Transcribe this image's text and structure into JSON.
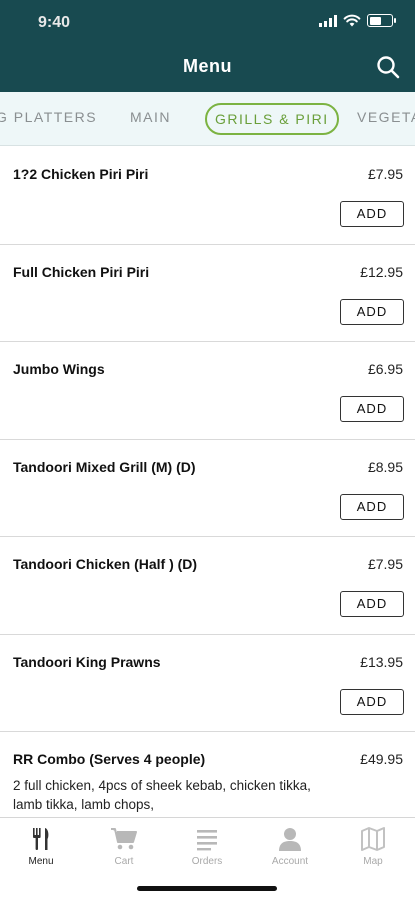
{
  "status_bar": {
    "time": "9:40"
  },
  "header": {
    "title": "Menu",
    "search_icon": "search-icon"
  },
  "tabs": [
    {
      "label": "G PLATTERS",
      "active": false
    },
    {
      "label": "MAIN",
      "active": false
    },
    {
      "label": "GRILLS & PIRI",
      "active": true
    },
    {
      "label": "VEGETA",
      "active": false
    }
  ],
  "items": [
    {
      "name": "1?2 Chicken Piri Piri",
      "price": "£7.95",
      "button": "ADD"
    },
    {
      "name": "Full Chicken Piri Piri",
      "price": "£12.95",
      "button": "ADD"
    },
    {
      "name": "Jumbo Wings",
      "price": "£6.95",
      "button": "ADD"
    },
    {
      "name": "Tandoori Mixed Grill (M) (D)",
      "price": "£8.95",
      "button": "ADD"
    },
    {
      "name": "Tandoori Chicken (Half ) (D)",
      "price": "£7.95",
      "button": "ADD"
    },
    {
      "name": "Tandoori King Prawns",
      "price": "£13.95",
      "button": "ADD"
    },
    {
      "name": "RR Combo (Serves 4 people)",
      "price": "£49.95",
      "description": "2 full chicken, 4pcs of sheek kebab, chicken tikka, lamb tikka, lamb chops,"
    }
  ],
  "tabbar": [
    {
      "label": "Menu",
      "icon": "fork-knife-icon",
      "active": true
    },
    {
      "label": "Cart",
      "icon": "cart-icon",
      "active": false
    },
    {
      "label": "Orders",
      "icon": "orders-list-icon",
      "active": false
    },
    {
      "label": "Account",
      "icon": "account-icon",
      "active": false
    },
    {
      "label": "Map",
      "icon": "map-icon",
      "active": false
    }
  ],
  "colors": {
    "header_bg": "#184a50",
    "active_tab": "#7cb342",
    "tabs_bg": "#eef7f8"
  }
}
